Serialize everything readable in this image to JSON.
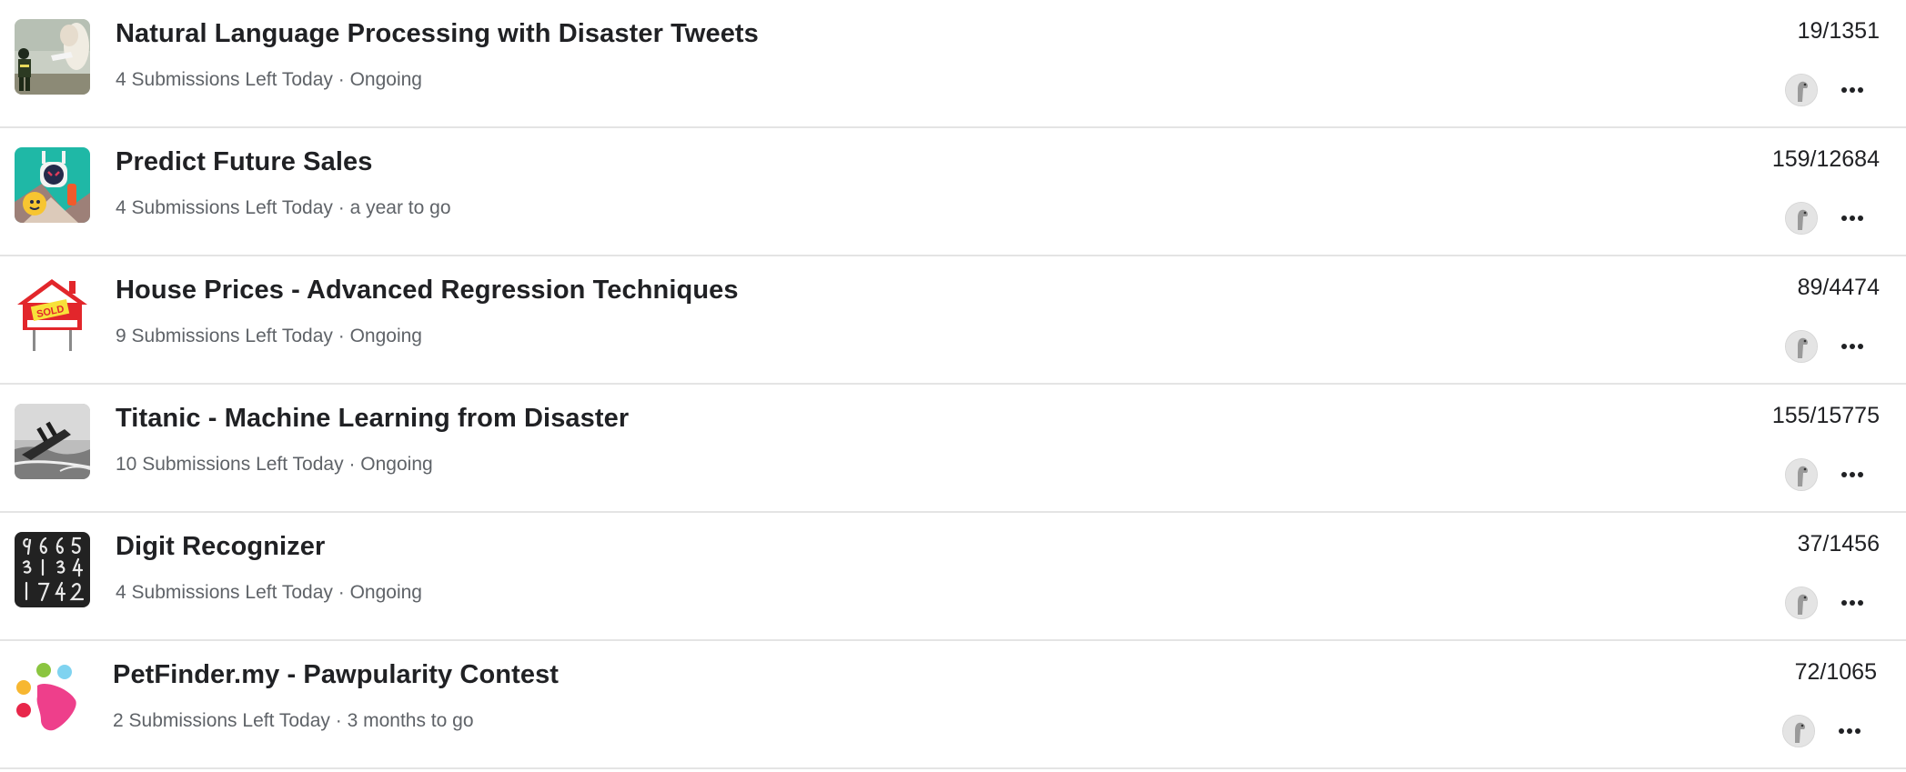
{
  "competitions": [
    {
      "icon": "firefighter-thumbnail-icon",
      "title": "Natural Language Processing with Disaster Tweets",
      "submissions": "4 Submissions Left Today",
      "separator": " · ",
      "status": "Ongoing",
      "rank": "19/1351"
    },
    {
      "icon": "robot-thumbnail-icon",
      "title": "Predict Future Sales",
      "submissions": "4 Submissions Left Today",
      "separator": " · ",
      "status": "a year to go",
      "rank": "159/12684"
    },
    {
      "icon": "sold-house-sign-icon",
      "title": "House Prices - Advanced Regression Techniques",
      "submissions": "9 Submissions Left Today",
      "separator": " · ",
      "status": "Ongoing",
      "rank": "89/4474"
    },
    {
      "icon": "titanic-ship-thumbnail-icon",
      "title": "Titanic - Machine Learning from Disaster",
      "submissions": "10 Submissions Left Today",
      "separator": " · ",
      "status": "Ongoing",
      "rank": "155/15775"
    },
    {
      "icon": "handwritten-digits-thumbnail-icon",
      "title": "Digit Recognizer",
      "submissions": "4 Submissions Left Today",
      "separator": " · ",
      "status": "Ongoing",
      "rank": "37/1456"
    },
    {
      "icon": "paw-logo-icon",
      "title": "PetFinder.my - Pawpularity Contest",
      "submissions": "2 Submissions Left Today",
      "separator": " · ",
      "status": "3 months to go",
      "rank": "72/1065"
    }
  ],
  "row_actions": {
    "avatar_icon": "user-avatar-icon",
    "more_icon": "more-options-icon"
  },
  "colors": {
    "text_primary": "#202124",
    "text_secondary": "#5f6368",
    "divider": "#e4e4e4"
  }
}
